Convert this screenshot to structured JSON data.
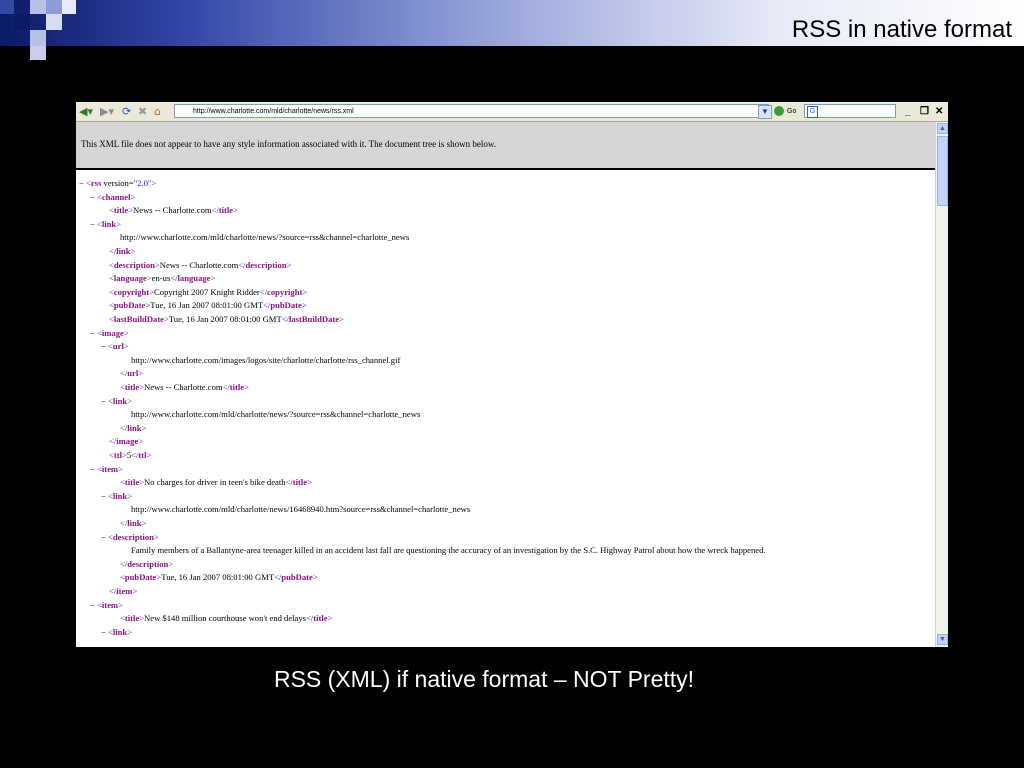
{
  "slide": {
    "title": "RSS in native format",
    "caption": "RSS (XML) if native format – NOT Pretty!"
  },
  "browser": {
    "address": "http://www.charlotte.com/mld/charlotte/news/rss.xml",
    "go_label": "Go",
    "search_icon_letter": "G",
    "info_text": "This XML file does not appear to have any style information associated with it. The document tree is shown below.",
    "colors": {
      "tag": "#881280",
      "bracket": "#1a1aa6",
      "infobar": "#d6d6d6"
    }
  },
  "xml_tree": [
    {
      "indent": 0,
      "minus": true,
      "parts": [
        [
          "b",
          "<"
        ],
        [
          "t",
          "rss"
        ],
        [
          "x",
          " version="
        ],
        [
          "v",
          "\"2.0\""
        ],
        [
          "b",
          ">"
        ]
      ]
    },
    {
      "indent": 1,
      "minus": true,
      "parts": [
        [
          "b",
          "<"
        ],
        [
          "t",
          "channel"
        ],
        [
          "b",
          ">"
        ]
      ]
    },
    {
      "indent": 2,
      "minus": false,
      "parts": [
        [
          "b",
          "<"
        ],
        [
          "t",
          "title"
        ],
        [
          "b",
          ">"
        ],
        [
          "x",
          "News -- Charlotte.com"
        ],
        [
          "b",
          "</"
        ],
        [
          "t",
          "title"
        ],
        [
          "b",
          ">"
        ]
      ]
    },
    {
      "indent": 1,
      "minus": true,
      "parts": [
        [
          "b",
          "<"
        ],
        [
          "t",
          "link"
        ],
        [
          "b",
          ">"
        ]
      ]
    },
    {
      "indent": 3,
      "minus": false,
      "parts": [
        [
          "x",
          "http://www.charlotte.com/mld/charlotte/news/?source=rss&channel=charlotte_news"
        ]
      ]
    },
    {
      "indent": 2,
      "minus": false,
      "parts": [
        [
          "b",
          "</"
        ],
        [
          "t",
          "link"
        ],
        [
          "b",
          ">"
        ]
      ]
    },
    {
      "indent": 2,
      "minus": false,
      "parts": [
        [
          "b",
          "<"
        ],
        [
          "t",
          "description"
        ],
        [
          "b",
          ">"
        ],
        [
          "x",
          "News -- Charlotte.com"
        ],
        [
          "b",
          "</"
        ],
        [
          "t",
          "description"
        ],
        [
          "b",
          ">"
        ]
      ]
    },
    {
      "indent": 2,
      "minus": false,
      "parts": [
        [
          "b",
          "<"
        ],
        [
          "t",
          "language"
        ],
        [
          "b",
          ">"
        ],
        [
          "x",
          "en-us"
        ],
        [
          "b",
          "</"
        ],
        [
          "t",
          "language"
        ],
        [
          "b",
          ">"
        ]
      ]
    },
    {
      "indent": 2,
      "minus": false,
      "parts": [
        [
          "b",
          "<"
        ],
        [
          "t",
          "copyright"
        ],
        [
          "b",
          ">"
        ],
        [
          "x",
          "Copyright 2007 Knight Ridder"
        ],
        [
          "b",
          "</"
        ],
        [
          "t",
          "copyright"
        ],
        [
          "b",
          ">"
        ]
      ]
    },
    {
      "indent": 2,
      "minus": false,
      "parts": [
        [
          "b",
          "<"
        ],
        [
          "t",
          "pubDate"
        ],
        [
          "b",
          ">"
        ],
        [
          "x",
          "Tue, 16 Jan 2007 08:01:00 GMT"
        ],
        [
          "b",
          "</"
        ],
        [
          "t",
          "pubDate"
        ],
        [
          "b",
          ">"
        ]
      ]
    },
    {
      "indent": 2,
      "minus": false,
      "parts": [
        [
          "b",
          "<"
        ],
        [
          "t",
          "lastBuildDate"
        ],
        [
          "b",
          ">"
        ],
        [
          "x",
          "Tue, 16 Jan 2007 08:01:00 GMT"
        ],
        [
          "b",
          "</"
        ],
        [
          "t",
          "lastBuildDate"
        ],
        [
          "b",
          ">"
        ]
      ]
    },
    {
      "indent": 1,
      "minus": true,
      "parts": [
        [
          "b",
          "<"
        ],
        [
          "t",
          "image"
        ],
        [
          "b",
          ">"
        ]
      ]
    },
    {
      "indent": 2,
      "minus": true,
      "parts": [
        [
          "b",
          "<"
        ],
        [
          "t",
          "url"
        ],
        [
          "b",
          ">"
        ]
      ]
    },
    {
      "indent": 4,
      "minus": false,
      "parts": [
        [
          "x",
          "http://www.charlotte.com/images/logos/site/charlotte/charlotte/rss_channel.gif"
        ]
      ]
    },
    {
      "indent": 3,
      "minus": false,
      "parts": [
        [
          "b",
          "</"
        ],
        [
          "t",
          "url"
        ],
        [
          "b",
          ">"
        ]
      ]
    },
    {
      "indent": 3,
      "minus": false,
      "parts": [
        [
          "b",
          "<"
        ],
        [
          "t",
          "title"
        ],
        [
          "b",
          ">"
        ],
        [
          "x",
          "News -- Charlotte.com"
        ],
        [
          "b",
          "</"
        ],
        [
          "t",
          "title"
        ],
        [
          "b",
          ">"
        ]
      ]
    },
    {
      "indent": 2,
      "minus": true,
      "parts": [
        [
          "b",
          "<"
        ],
        [
          "t",
          "link"
        ],
        [
          "b",
          ">"
        ]
      ]
    },
    {
      "indent": 4,
      "minus": false,
      "parts": [
        [
          "x",
          "http://www.charlotte.com/mld/charlotte/news/?source=rss&channel=charlotte_news"
        ]
      ]
    },
    {
      "indent": 3,
      "minus": false,
      "parts": [
        [
          "b",
          "</"
        ],
        [
          "t",
          "link"
        ],
        [
          "b",
          ">"
        ]
      ]
    },
    {
      "indent": 2,
      "minus": false,
      "parts": [
        [
          "b",
          "</"
        ],
        [
          "t",
          "image"
        ],
        [
          "b",
          ">"
        ]
      ]
    },
    {
      "indent": 2,
      "minus": false,
      "parts": [
        [
          "b",
          "<"
        ],
        [
          "t",
          "ttl"
        ],
        [
          "b",
          ">"
        ],
        [
          "x",
          "5"
        ],
        [
          "b",
          "</"
        ],
        [
          "t",
          "ttl"
        ],
        [
          "b",
          ">"
        ]
      ]
    },
    {
      "indent": 1,
      "minus": true,
      "parts": [
        [
          "b",
          "<"
        ],
        [
          "t",
          "item"
        ],
        [
          "b",
          ">"
        ]
      ]
    },
    {
      "indent": 3,
      "minus": false,
      "parts": [
        [
          "b",
          "<"
        ],
        [
          "t",
          "title"
        ],
        [
          "b",
          ">"
        ],
        [
          "x",
          "No charges for driver in teen's bike death"
        ],
        [
          "b",
          "</"
        ],
        [
          "t",
          "title"
        ],
        [
          "b",
          ">"
        ]
      ]
    },
    {
      "indent": 2,
      "minus": true,
      "parts": [
        [
          "b",
          "<"
        ],
        [
          "t",
          "link"
        ],
        [
          "b",
          ">"
        ]
      ]
    },
    {
      "indent": 4,
      "minus": false,
      "parts": [
        [
          "x",
          "http://www.charlotte.com/mld/charlotte/news/16468940.htm?source=rss&channel=charlotte_news"
        ]
      ]
    },
    {
      "indent": 3,
      "minus": false,
      "parts": [
        [
          "b",
          "</"
        ],
        [
          "t",
          "link"
        ],
        [
          "b",
          ">"
        ]
      ]
    },
    {
      "indent": 2,
      "minus": true,
      "parts": [
        [
          "b",
          "<"
        ],
        [
          "t",
          "description"
        ],
        [
          "b",
          ">"
        ]
      ]
    },
    {
      "indent": 4,
      "minus": false,
      "parts": [
        [
          "x",
          "Family members of a Ballantyne-area teenager killed in an accident last fall are questioning the accuracy of an investigation by the S.C. Highway Patrol about how the wreck happened."
        ]
      ]
    },
    {
      "indent": 3,
      "minus": false,
      "parts": [
        [
          "b",
          "</"
        ],
        [
          "t",
          "description"
        ],
        [
          "b",
          ">"
        ]
      ]
    },
    {
      "indent": 3,
      "minus": false,
      "parts": [
        [
          "b",
          "<"
        ],
        [
          "t",
          "pubDate"
        ],
        [
          "b",
          ">"
        ],
        [
          "x",
          "Tue, 16 Jan 2007 08:01:00 GMT"
        ],
        [
          "b",
          "</"
        ],
        [
          "t",
          "pubDate"
        ],
        [
          "b",
          ">"
        ]
      ]
    },
    {
      "indent": 2,
      "minus": false,
      "parts": [
        [
          "b",
          "</"
        ],
        [
          "t",
          "item"
        ],
        [
          "b",
          ">"
        ]
      ]
    },
    {
      "indent": 1,
      "minus": true,
      "parts": [
        [
          "b",
          "<"
        ],
        [
          "t",
          "item"
        ],
        [
          "b",
          ">"
        ]
      ]
    },
    {
      "indent": 3,
      "minus": false,
      "parts": [
        [
          "b",
          "<"
        ],
        [
          "t",
          "title"
        ],
        [
          "b",
          ">"
        ],
        [
          "x",
          "New $148 million courthouse won't end delays"
        ],
        [
          "b",
          "</"
        ],
        [
          "t",
          "title"
        ],
        [
          "b",
          ">"
        ]
      ]
    },
    {
      "indent": 2,
      "minus": true,
      "parts": [
        [
          "b",
          "<"
        ],
        [
          "t",
          "link"
        ],
        [
          "b",
          ">"
        ]
      ]
    }
  ]
}
